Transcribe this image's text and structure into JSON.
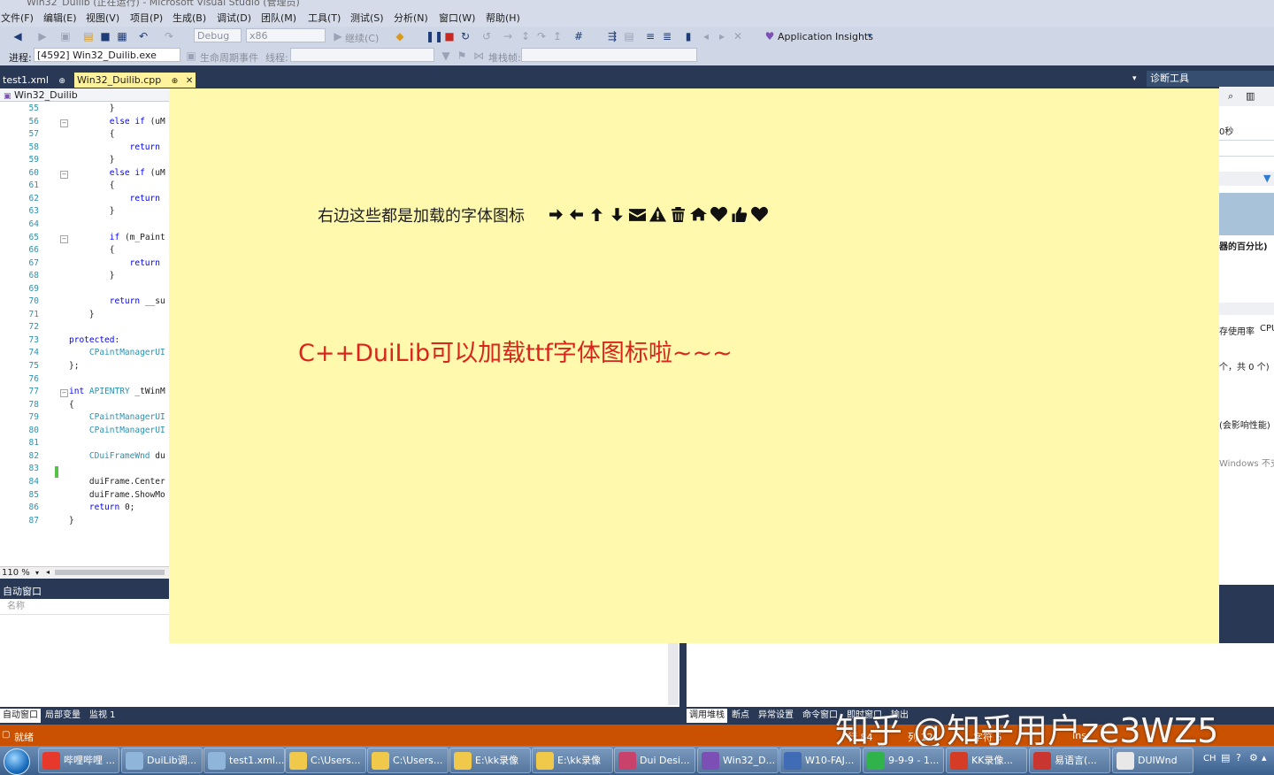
{
  "window": {
    "title": "Win32_Duilib (正在运行) - Microsoft Visual Studio (管理员)"
  },
  "menu": [
    "文件(F)",
    "编辑(E)",
    "视图(V)",
    "项目(P)",
    "生成(B)",
    "调试(D)",
    "团队(M)",
    "工具(T)",
    "测试(S)",
    "分析(N)",
    "窗口(W)",
    "帮助(H)"
  ],
  "toolbar": {
    "config": "Debug",
    "platform": "x86",
    "continue": "继续(C)",
    "app_insights": "Application Insights"
  },
  "debugbar": {
    "process_label": "进程:",
    "process_value": "[4592] Win32_Duilib.exe",
    "lifecycle": "生命周期事件",
    "thread_label": "线程:",
    "stackframe_label": "堆栈帧:"
  },
  "tabs": [
    {
      "label": "test1.xml",
      "pin": "⊕"
    },
    {
      "label": "Win32_Duilib.cpp",
      "pin": "⊕",
      "close": "✕"
    }
  ],
  "editor": {
    "nav": "Win32_Duilib",
    "zoom": "110 %",
    "lines": [
      {
        "n": "55",
        "code": "        }"
      },
      {
        "n": "56",
        "code": "        else if (uM"
      },
      {
        "n": "57",
        "code": "        {"
      },
      {
        "n": "58",
        "code": "            return"
      },
      {
        "n": "59",
        "code": "        }"
      },
      {
        "n": "60",
        "code": "        else if (uM"
      },
      {
        "n": "61",
        "code": "        {"
      },
      {
        "n": "62",
        "code": "            return"
      },
      {
        "n": "63",
        "code": "        }"
      },
      {
        "n": "64",
        "code": ""
      },
      {
        "n": "65",
        "code": "        if (m_Paint"
      },
      {
        "n": "66",
        "code": "        {"
      },
      {
        "n": "67",
        "code": "            return"
      },
      {
        "n": "68",
        "code": "        }"
      },
      {
        "n": "69",
        "code": ""
      },
      {
        "n": "70",
        "code": "        return __su"
      },
      {
        "n": "71",
        "code": "    }"
      },
      {
        "n": "72",
        "code": ""
      },
      {
        "n": "73",
        "code": "protected:"
      },
      {
        "n": "74",
        "code": "    CPaintManagerUI"
      },
      {
        "n": "75",
        "code": "};"
      },
      {
        "n": "76",
        "code": ""
      },
      {
        "n": "77",
        "code": "int APIENTRY _tWinM"
      },
      {
        "n": "78",
        "code": "{"
      },
      {
        "n": "79",
        "code": "    CPaintManagerUI"
      },
      {
        "n": "80",
        "code": "    CPaintManagerUI"
      },
      {
        "n": "81",
        "code": ""
      },
      {
        "n": "82",
        "code": "    CDuiFrameWnd du"
      },
      {
        "n": "83",
        "code": ""
      },
      {
        "n": "84",
        "code": "    duiFrame.Center"
      },
      {
        "n": "85",
        "code": "    duiFrame.ShowMo"
      },
      {
        "n": "86",
        "code": "    return 0;"
      },
      {
        "n": "87",
        "code": "}"
      }
    ]
  },
  "autos": {
    "title": "自动窗口",
    "column_name": "名称"
  },
  "bottom_tabs_left": [
    "自动窗口",
    "局部变量",
    "监视 1"
  ],
  "bottom_tabs_right": [
    "调用堆栈",
    "断点",
    "异常设置",
    "命令窗口",
    "即时窗口",
    "输出"
  ],
  "status": {
    "ready": "就绪",
    "line": "行 84",
    "col": "列 12",
    "char": "字符 5",
    "ins": "Ins"
  },
  "diag": {
    "title": "诊断工具",
    "seconds": "0秒",
    "percent": "器的百分比)",
    "mem_usage": "存使用率",
    "cpu": "CPU",
    "count": "个，共 0 个)",
    "perf": "(会影响性能)",
    "windows": "Windows 不支持"
  },
  "dui_window": {
    "caption": "右边这些都是加载的字体图标",
    "headline": "C++DuiLib可以加载ttf字体图标啦~~~",
    "icons": [
      "arrow-right-icon",
      "arrow-left-icon",
      "arrow-up-icon",
      "arrow-down-icon",
      "envelope-icon",
      "warning-icon",
      "trash-icon",
      "home-icon",
      "heart-icon",
      "thumbs-up-icon",
      "heart-icon"
    ]
  },
  "taskbar": [
    {
      "label": "哔哩哔哩 ...",
      "color": "#e6392b"
    },
    {
      "label": "DuiLib调...",
      "color": "#8fb6da"
    },
    {
      "label": "test1.xml...",
      "color": "#8fb6da"
    },
    {
      "label": "C:\\Users...",
      "color": "#f0c94a"
    },
    {
      "label": "C:\\Users...",
      "color": "#f0c94a"
    },
    {
      "label": "E:\\kk录像",
      "color": "#f0c94a"
    },
    {
      "label": "E:\\kk录像",
      "color": "#f0c94a"
    },
    {
      "label": "Dui Desi...",
      "color": "#c8426b"
    },
    {
      "label": "Win32_D...",
      "color": "#7b4fb3"
    },
    {
      "label": "W10-FAJ...",
      "color": "#3f6cb5"
    },
    {
      "label": "9-9-9 - 1...",
      "color": "#2fb34a"
    },
    {
      "label": "KK录像...",
      "color": "#d43c25"
    },
    {
      "label": "易语言(...",
      "color": "#c9352f"
    },
    {
      "label": "DUIWnd",
      "color": "#e8e8e8"
    }
  ],
  "tray": {
    "lang": "CH"
  },
  "watermark": "知乎 @知乎用户ze3WZ5"
}
